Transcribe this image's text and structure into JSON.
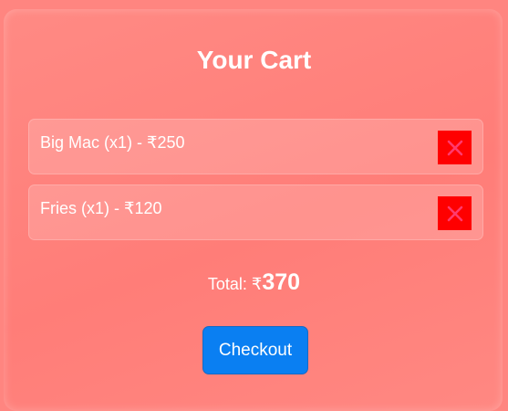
{
  "cart": {
    "title": "Your Cart",
    "items": [
      {
        "label": "Big Mac (x1) - ₹250",
        "remove_icon": "close-icon"
      },
      {
        "label": "Fries (x1) - ₹120",
        "remove_icon": "close-icon"
      }
    ],
    "total_label": "Total: ₹",
    "total_amount": "370",
    "checkout_label": "Checkout"
  },
  "colors": {
    "background": "#ff8580",
    "remove_button": "#ff0000",
    "remove_icon": "#ff3a6e",
    "checkout_button": "#0a7ff2",
    "text": "#ffffff"
  }
}
